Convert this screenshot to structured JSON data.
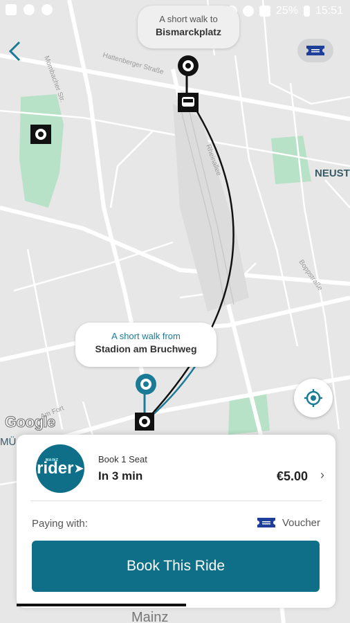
{
  "status_bar": {
    "battery": "25%",
    "time": "15:51"
  },
  "map": {
    "labels": {
      "neust": "NEUST",
      "mu": "MÜ",
      "mainz": "Mainz"
    },
    "street_names": [
      "Mombacher Str.",
      "Hattenberger Straße",
      "Rheinallee",
      "Am Fort",
      "Boppstraße"
    ]
  },
  "pickup_bubble": {
    "hint": "A short walk to",
    "place": "Bismarckplatz"
  },
  "dropoff_bubble": {
    "hint": "A short walk from",
    "place": "Stadion am Bruchweg"
  },
  "attribution": "Google",
  "ride_card": {
    "logo_small": "MAINZ",
    "logo_text": "rider",
    "seat_label": "Book 1 Seat",
    "eta": "In 3 min",
    "price": "€5.00",
    "paying_label": "Paying with:",
    "payment_method": "Voucher",
    "book_button": "Book This Ride"
  },
  "colors": {
    "accent": "#0f6f88",
    "route_black": "#111111",
    "route_teal": "#1b7b96",
    "park_green": "#b8e2c7"
  },
  "icons": [
    "back-arrow-icon",
    "ticket-icon",
    "bus-stop-icon",
    "pin-icon",
    "locate-icon",
    "chevron-right-icon",
    "voucher-icon"
  ]
}
